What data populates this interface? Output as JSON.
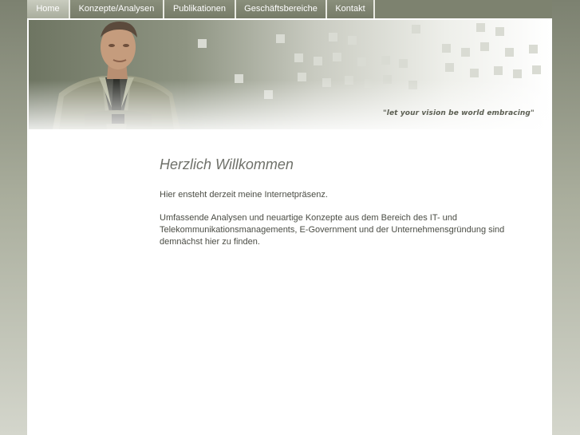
{
  "nav": {
    "items": [
      {
        "label": "Home",
        "active": true
      },
      {
        "label": "Konzepte/Analysen",
        "active": false
      },
      {
        "label": "Publikationen",
        "active": false
      },
      {
        "label": "Geschäftsbereiche",
        "active": false
      },
      {
        "label": "Kontakt",
        "active": false
      }
    ]
  },
  "banner": {
    "tagline": "\"let your vision be world embracing\""
  },
  "content": {
    "heading": "Herzlich Willkommen",
    "paragraph1": "Hier ensteht derzeit meine Internetpräsenz.",
    "paragraph2": "Umfassende Analysen und neuartige Konzepte aus dem Bereich des IT- und Telekommunikationsmanagements, E-Government und der Unternehmensgründung sind demnächst hier zu finden."
  },
  "colors": {
    "nav_background": "#7d826f",
    "nav_active": "#c9ccbf",
    "heading": "#6f716a",
    "text": "#4b4d45"
  }
}
